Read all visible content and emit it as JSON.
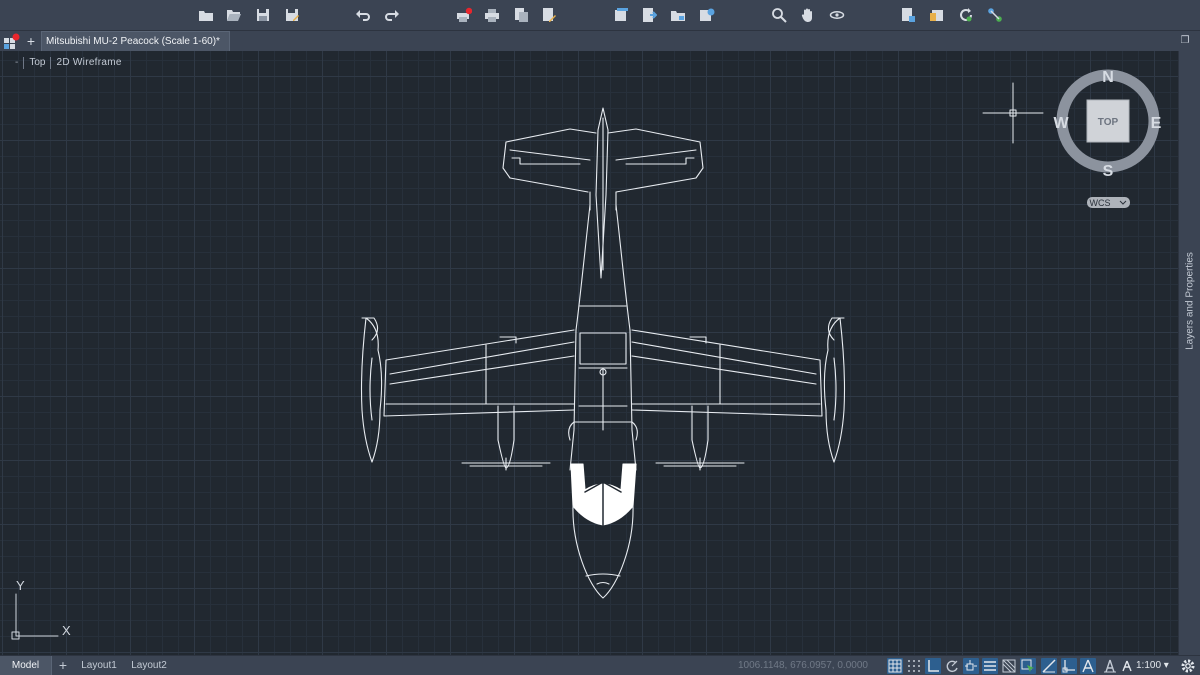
{
  "toolbar": {
    "buttons": [
      {
        "name": "new-drawing-button",
        "icon": "folder-new-icon"
      },
      {
        "name": "open-button",
        "icon": "folder-open-icon"
      },
      {
        "name": "save-button",
        "icon": "save-icon"
      },
      {
        "name": "save-as-button",
        "icon": "save-as-icon"
      },
      {
        "name": "undo-button",
        "icon": "undo-icon"
      },
      {
        "name": "redo-button",
        "icon": "redo-icon"
      },
      {
        "name": "plot-button",
        "icon": "printer-alert-icon"
      },
      {
        "name": "batch-plot-button",
        "icon": "printer-icon"
      },
      {
        "name": "export-button",
        "icon": "export-icon"
      },
      {
        "name": "publish-button",
        "icon": "publish-icon"
      },
      {
        "name": "sheet-set-button",
        "icon": "sheet-set-icon"
      },
      {
        "name": "sheet-list-button",
        "icon": "sheet-list-icon"
      },
      {
        "name": "folder-button",
        "icon": "folder-icon"
      },
      {
        "name": "share-button",
        "icon": "share-icon"
      },
      {
        "name": "zoom-button",
        "icon": "zoom-icon"
      },
      {
        "name": "pan-button",
        "icon": "hand-icon"
      },
      {
        "name": "orbit-button",
        "icon": "orbit-icon"
      },
      {
        "name": "properties-button",
        "icon": "properties-icon"
      },
      {
        "name": "markup-button",
        "icon": "markup-icon"
      },
      {
        "name": "refresh-button",
        "icon": "refresh-icon"
      },
      {
        "name": "connect-button",
        "icon": "connect-icon"
      }
    ]
  },
  "tabs": {
    "document_title": "Mitsubishi MU-2 Peacock (Scale 1-60)*",
    "new_tab_label": "+",
    "overflow_label": "❐"
  },
  "viewport": {
    "minus_label": "-",
    "view_label": "Top",
    "visual_style_label": "2D Wireframe"
  },
  "viewcube": {
    "north": "N",
    "south": "S",
    "east": "E",
    "west": "W",
    "face": "TOP",
    "ucs_label": "WCS"
  },
  "ucs_icon": {
    "y_label": "Y",
    "x_label": "X"
  },
  "palette": {
    "label": "Layers and Properties"
  },
  "statusbar": {
    "model_tab": "Model",
    "add_layout": "+",
    "layout1": "Layout1",
    "layout2": "Layout2",
    "coordinates": "1006.1148, 676.0957, 0.0000",
    "scale": "1:100 ▾",
    "toggles": [
      {
        "name": "grid-toggle",
        "icon": "grid-icon",
        "on": true
      },
      {
        "name": "snap-toggle",
        "icon": "snap-icon",
        "on": false
      },
      {
        "name": "ortho-toggle",
        "icon": "ortho-icon",
        "on": true
      },
      {
        "name": "polar-toggle",
        "icon": "polar-icon",
        "on": false
      },
      {
        "name": "osnap-toggle",
        "icon": "osnap-icon",
        "on": true
      },
      {
        "name": "lineweight-toggle",
        "icon": "lineweight-icon",
        "on": true
      },
      {
        "name": "transparency-toggle",
        "icon": "transparency-icon",
        "on": false
      },
      {
        "name": "selection-cycling-toggle",
        "icon": "selection-cycling-icon",
        "on": true
      },
      {
        "name": "dynamic-input-toggle",
        "icon": "dynamic-input-icon",
        "on": true
      },
      {
        "name": "ucs-toggle",
        "icon": "ucs-icon",
        "on": true
      },
      {
        "name": "annotation-visibility-toggle",
        "icon": "annotation-visibility-icon",
        "on": true
      },
      {
        "name": "annotation-scale-toggle",
        "icon": "annotation-scale-icon",
        "on": false
      }
    ]
  },
  "colors": {
    "background": "#212830",
    "chrome": "#3b4453",
    "wire": "#e8ecf1",
    "accent_on": "#2d5f8f",
    "alert_red": "#e8262d"
  }
}
